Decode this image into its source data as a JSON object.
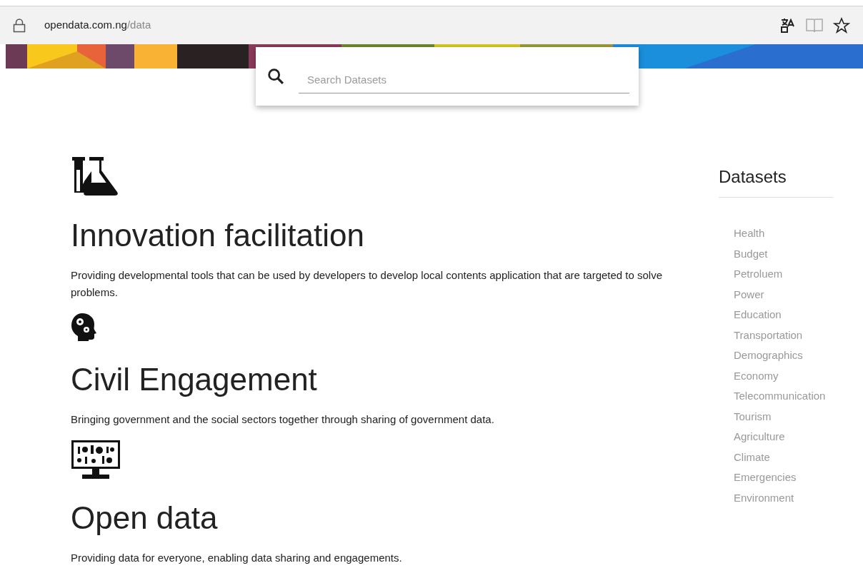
{
  "address_bar": {
    "host": "opendata.com.ng",
    "path": "/data"
  },
  "search": {
    "placeholder": "Search Datasets"
  },
  "sections": [
    {
      "kind": "flask",
      "title": "Innovation facilitation",
      "text": "Providing developmental tools that can be used by developers to develop local contents application that are targeted to solve problems."
    },
    {
      "kind": "head",
      "title": "Civil Engagement",
      "text": "Bringing government and the social sectors together through sharing of government data."
    },
    {
      "kind": "monitor",
      "title": "Open data",
      "text": "Providing data for everyone, enabling data sharing and engagements."
    }
  ],
  "sidebar": {
    "title": "Datasets",
    "items": [
      "Health",
      "Budget",
      "Petroluem",
      "Power",
      "Education",
      "Transportation",
      "Demographics",
      "Economy",
      "Telecommunication",
      "Tourism",
      "Agriculture",
      "Climate",
      "Emergencies",
      "Environment"
    ]
  }
}
